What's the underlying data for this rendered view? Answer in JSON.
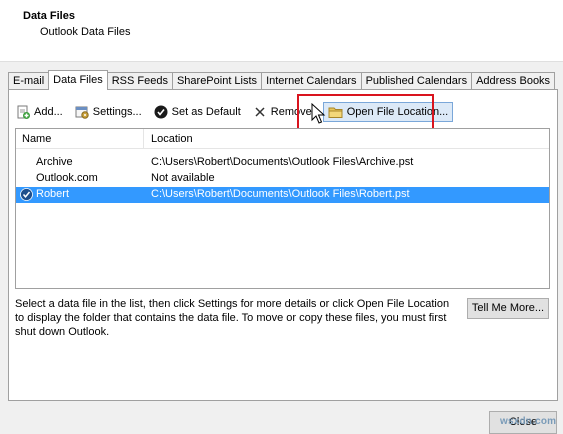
{
  "header": {
    "title": "Data Files",
    "subtitle": "Outlook Data Files"
  },
  "tabs": [
    {
      "label": "E-mail",
      "active": false
    },
    {
      "label": "Data Files",
      "active": true
    },
    {
      "label": "RSS Feeds",
      "active": false
    },
    {
      "label": "SharePoint Lists",
      "active": false
    },
    {
      "label": "Internet Calendars",
      "active": false
    },
    {
      "label": "Published Calendars",
      "active": false
    },
    {
      "label": "Address Books",
      "active": false
    }
  ],
  "toolbar": {
    "add_label": "Add...",
    "settings_label": "Settings...",
    "default_label": "Set as Default",
    "remove_label": "Remove",
    "open_location_label": "Open File Location..."
  },
  "list": {
    "col_name": "Name",
    "col_location": "Location",
    "rows": [
      {
        "name": "Archive",
        "location": "C:\\Users\\Robert\\Documents\\Outlook Files\\Archive.pst",
        "selected": false,
        "default": false
      },
      {
        "name": "Outlook.com",
        "location": "Not available",
        "selected": false,
        "default": false
      },
      {
        "name": "Robert",
        "location": "C:\\Users\\Robert\\Documents\\Outlook Files\\Robert.pst",
        "selected": true,
        "default": true
      }
    ]
  },
  "description": "Select a data file in the list, then click Settings for more details or click Open File Location to display the folder that contains the data file. To move or copy these files, you must first shut down Outlook.",
  "tell_me_more_label": "Tell Me More...",
  "close_label": "Close",
  "watermark": "wsxdn.com",
  "colors": {
    "selection": "#3399ff",
    "highlight_box": "#d9141e"
  },
  "icons": [
    "add-icon",
    "settings-icon",
    "checkmark-circle-icon",
    "remove-x-icon",
    "folder-icon",
    "default-check-icon",
    "cursor-icon"
  ]
}
